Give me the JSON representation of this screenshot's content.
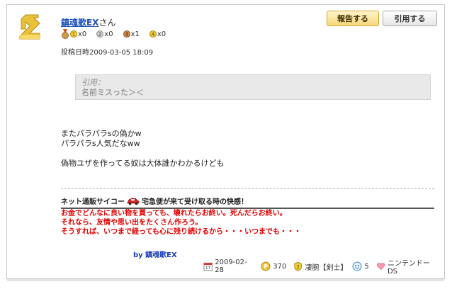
{
  "user": {
    "name": "鎮魂歌EX",
    "suffix": "さん",
    "medals": [
      {
        "rank": "1",
        "count": "x0"
      },
      {
        "rank": "2",
        "count": "x0"
      },
      {
        "rank": "3",
        "count": "x1"
      },
      {
        "rank": "4",
        "count": "x0"
      }
    ],
    "post_date": "投稿日時2009-03-05 18:09"
  },
  "buttons": {
    "report": "報告する",
    "quote": "引用する"
  },
  "quote": {
    "label": "引用：",
    "text": "名前ミスった＞＜"
  },
  "body": {
    "lines": [
      "またパラパラsの偽かw",
      "パラパラs人気だなww",
      "",
      "偽物ユザを作ってる奴は大体誰かわかるけども"
    ]
  },
  "signature": {
    "head_before": "ネット通販サイコー",
    "head_after": "宅急便が来て受け取る時の快感！",
    "lines": [
      "お金でどんなに良い物を買っても、壊れたらお終い。死んだらお終い。",
      "それなら、友情や思い出をたくさん作ろう。",
      "そうすれば、いつまで経っても心に残り続けるから・・・いつまでも・・・"
    ],
    "by_prefix": "by ",
    "by_name": "鎮魂歌EX"
  },
  "footer": {
    "date": "2009-02-28",
    "points": "370",
    "rank": "凄腕【剣士】",
    "count": "5",
    "platform": "ニンテンドーDS"
  },
  "colors": {
    "link": "#1a50b8",
    "signature_red": "#e00000",
    "report_button": "#f5d77a"
  }
}
